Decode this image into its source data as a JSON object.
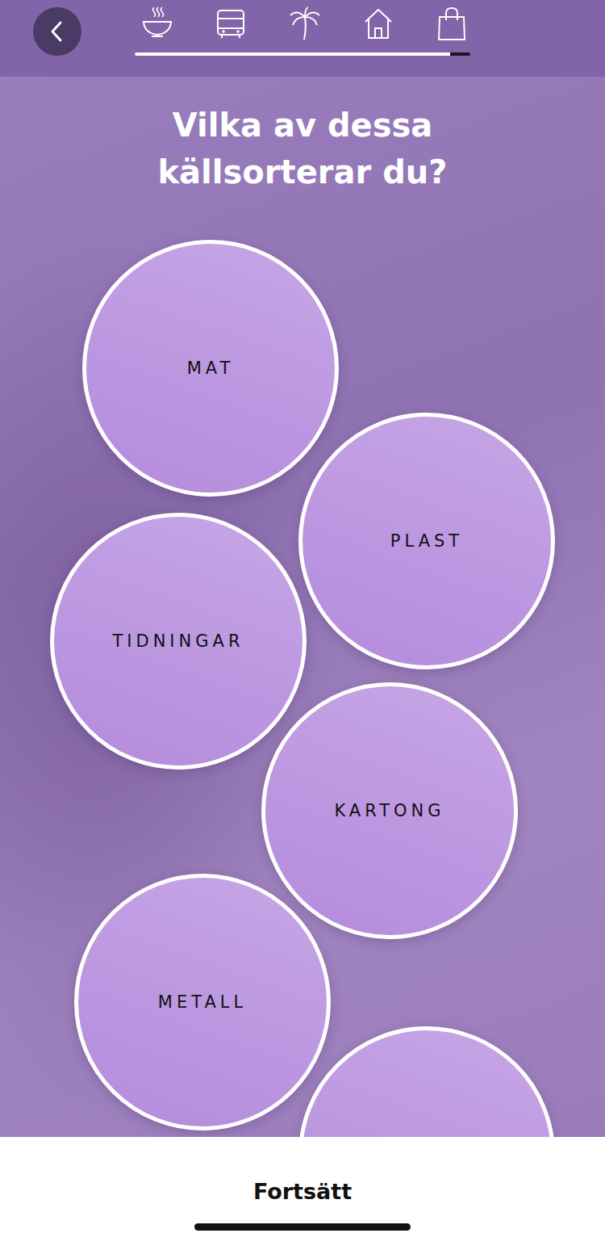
{
  "title": "Vilka av dessa\nkällsorterar du?",
  "progress": {
    "level": 0.94
  },
  "options": [
    {
      "label": "MAT",
      "selected": false
    },
    {
      "label": "PLAST",
      "selected": false
    },
    {
      "label": "TIDNINGAR",
      "selected": false
    },
    {
      "label": "KARTONG",
      "selected": false
    },
    {
      "label": "METALL",
      "selected": false
    },
    {
      "label": "",
      "selected": false
    }
  ],
  "continue_button": "Fortsätt"
}
